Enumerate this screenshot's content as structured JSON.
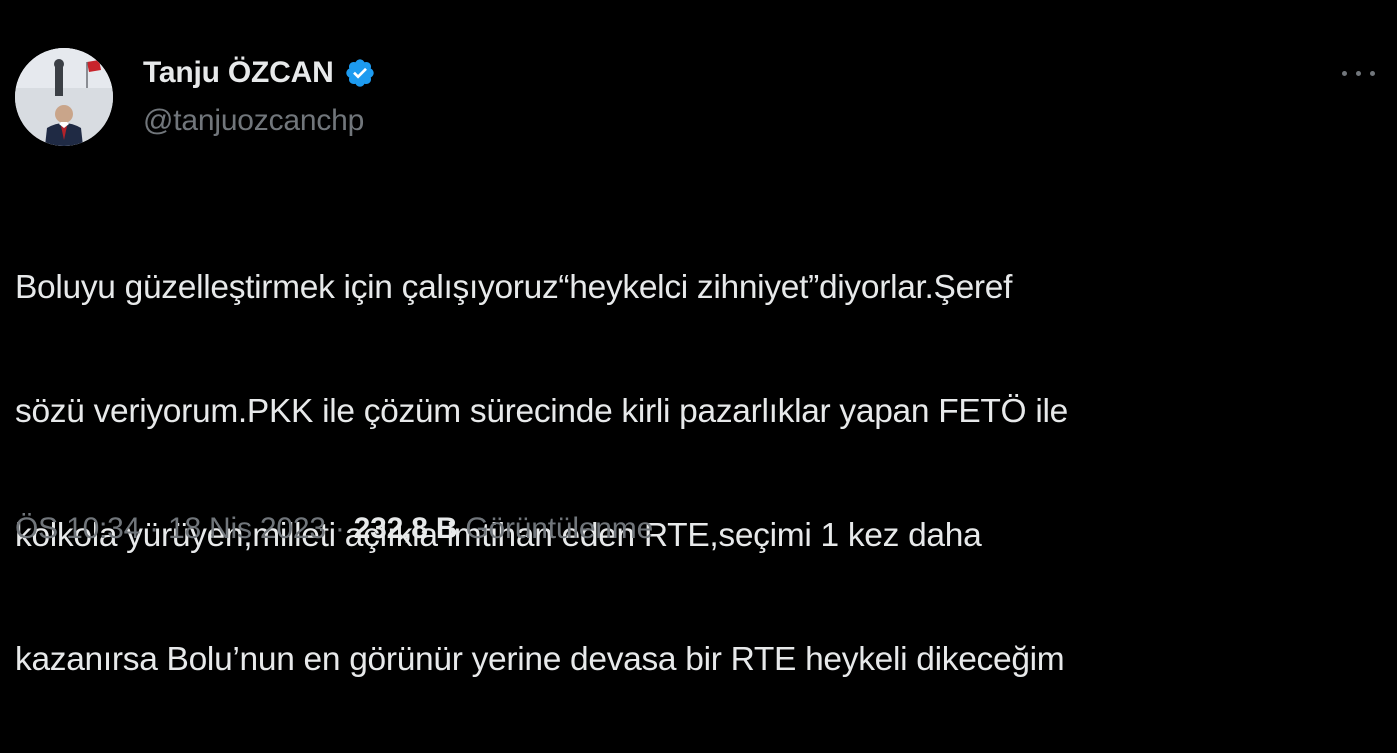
{
  "author": {
    "display_name": "Tanju ÖZCAN",
    "handle": "@tanjuozcanchp",
    "verified": true,
    "avatar_icon": "profile-photo"
  },
  "actions": {
    "more_icon": "more-horizontal-icon"
  },
  "tweet": {
    "lines": [
      "Boluyu güzelleştirmek için çalışıyoruz“heykelci zihniyet”diyorlar.Şeref",
      "sözü veriyorum.PKK ile çözüm sürecinde kirli pazarlıklar yapan FETÖ ile",
      "kolkola yürüyen,milleti açlıkla imtihan eden RTE,seçimi 1 kez daha",
      "kazanırsa Bolu’nun en görünür yerine devasa bir RTE heykeli dikeceğim"
    ]
  },
  "meta": {
    "time": "ÖS 10:34",
    "separator": "·",
    "date": "18 Nis 2023",
    "views_count": "232,8 B",
    "views_label": "Görüntülenme"
  },
  "colors": {
    "background": "#000000",
    "text_primary": "#e7e9ea",
    "text_secondary": "#71767b",
    "verified_blue": "#1d9bf0"
  }
}
